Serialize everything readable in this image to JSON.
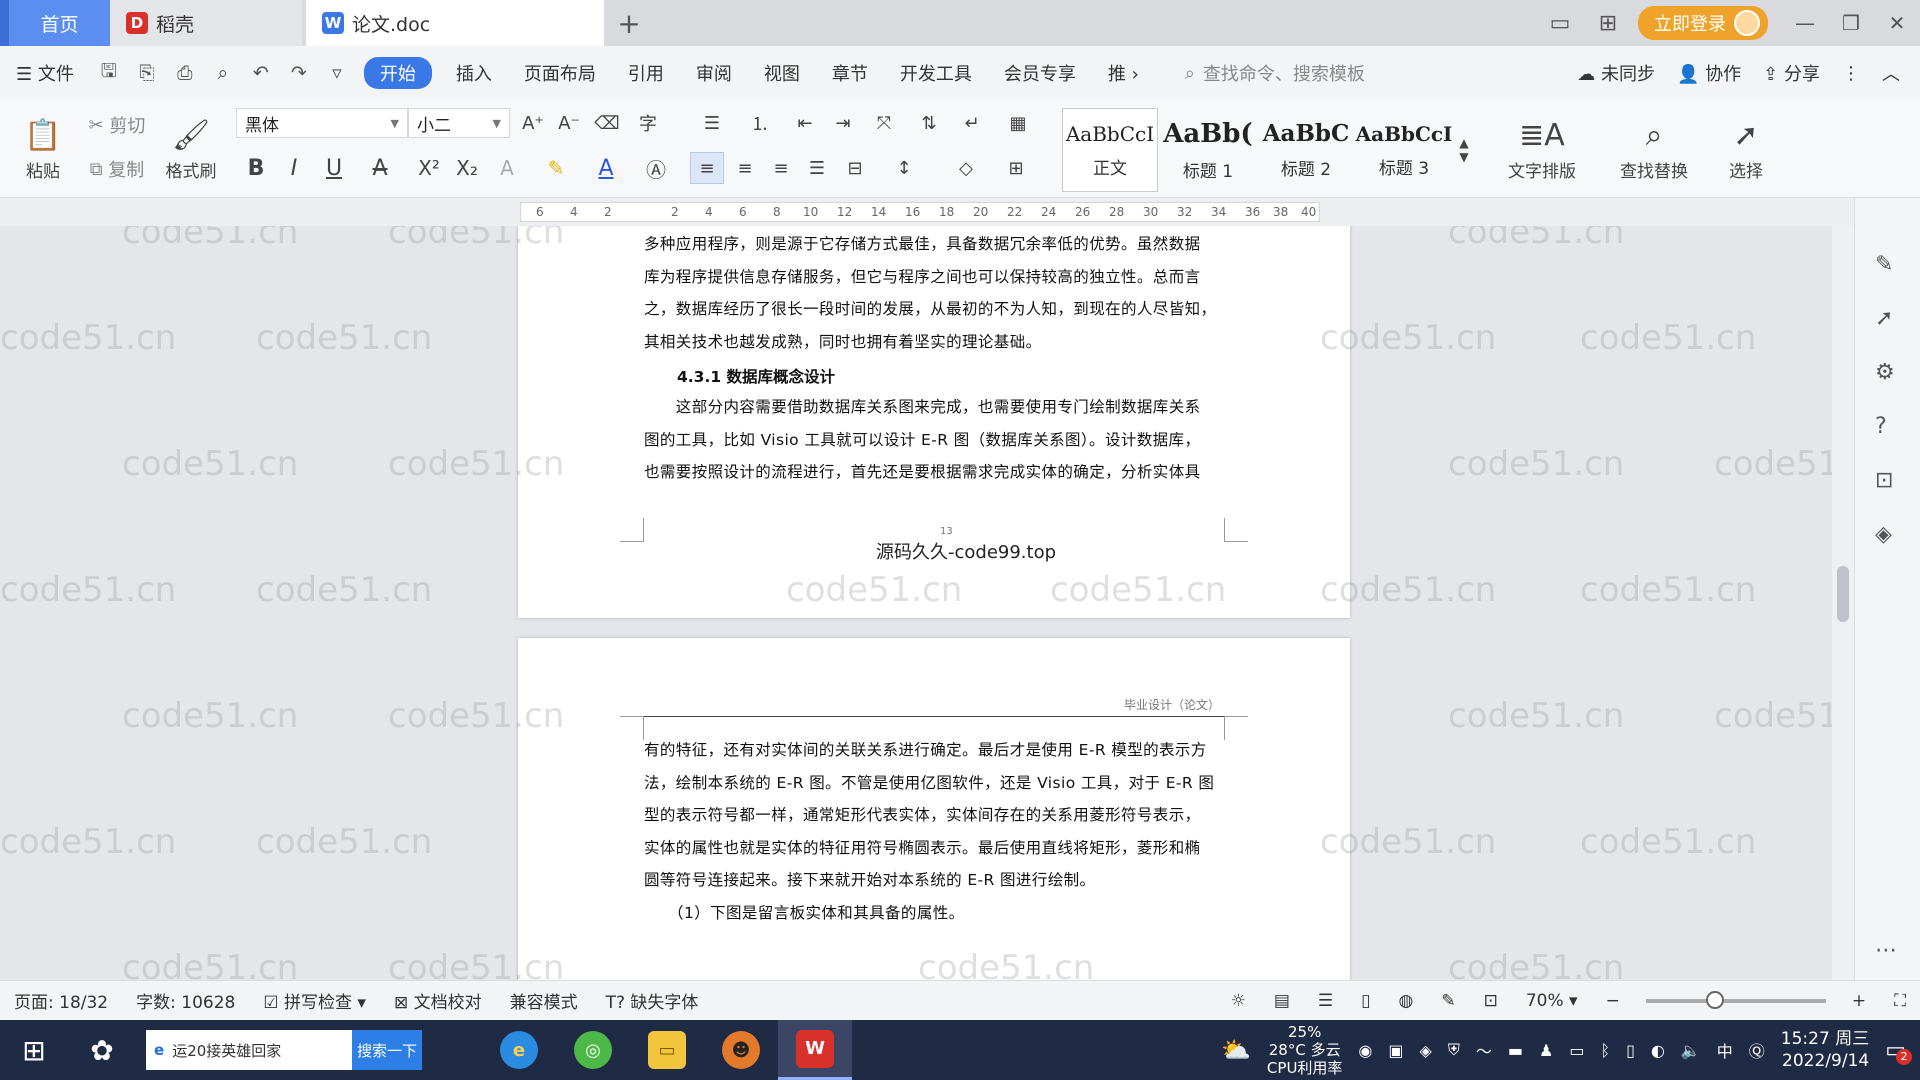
{
  "tabs": {
    "home": "首页",
    "docer": "稻壳",
    "doc": "论文.doc",
    "login": "立即登录"
  },
  "menu": {
    "file": "文件",
    "items": [
      "开始",
      "插入",
      "页面布局",
      "引用",
      "审阅",
      "视图",
      "章节",
      "开发工具",
      "会员专享",
      "推"
    ],
    "search_cmd": "查找命令、搜索模板",
    "unsynced": "未同步",
    "collab": "协作",
    "share": "分享"
  },
  "ribbon": {
    "paste": "粘贴",
    "cut": "剪切",
    "copy": "复制",
    "format_painter": "格式刷",
    "font_name": "黑体",
    "font_size": "小二",
    "styles": [
      {
        "sample": "AaBbCcI",
        "name": "正文"
      },
      {
        "sample": "AaBb(",
        "name": "标题 1"
      },
      {
        "sample": "AaBbC",
        "name": "标题 2"
      },
      {
        "sample": "AaBbCcI",
        "name": "标题 3"
      }
    ],
    "text_layout": "文字排版",
    "find_replace": "查找替换",
    "select": "选择"
  },
  "ruler": {
    "ticks": [
      "6",
      "4",
      "2",
      "",
      "2",
      "4",
      "6",
      "8",
      "10",
      "12",
      "14",
      "16",
      "18",
      "20",
      "22",
      "24",
      "26",
      "28",
      "30",
      "32",
      "34",
      "36",
      "38",
      "40"
    ]
  },
  "document": {
    "page1_lines": [
      "多种应用程序，则是源于它存储方式最佳，具备数据冗余率低的优势。虽然数据",
      "库为程序提供信息存储服务，但它与程序之间也可以保持较高的独立性。总而言",
      "之，数据库经历了很长一段时间的发展，从最初的不为人知，到现在的人尽皆知，",
      "其相关技术也越发成熟，同时也拥有着坚实的理论基础。"
    ],
    "heading": "4.3.1  数据库概念设计",
    "page1_lines_2": [
      "　　这部分内容需要借助数据库关系图来完成，也需要使用专门绘制数据库关系",
      "图的工具，比如 Visio 工具就可以设计 E-R 图（数据库关系图）。设计数据库，",
      "也需要按照设计的流程进行，首先还是要根据需求完成实体的确定，分析实体具"
    ],
    "page_number": "13",
    "footer": "源码久久-code99.top",
    "page2_header": "毕业设计（论文）",
    "page2_lines": [
      "有的特征，还有对实体间的关联关系进行确定。最后才是使用 E-R 模型的表示方",
      "法，绘制本系统的 E-R 图。不管是使用亿图软件，还是 Visio 工具，对于 E-R 图",
      "型的表示符号都一样，通常矩形代表实体，实体间存在的关系用菱形符号表示，",
      "实体的属性也就是实体的特征用符号椭圆表示。最后使用直线将矩形，菱形和椭",
      "圆等符号连接起来。接下来就开始对本系统的 E-R 图进行绘制。",
      "　　（1）下图是留言板实体和其具备的属性。"
    ],
    "watermark": "code51.cn"
  },
  "statusbar": {
    "page": "页面: 18/32",
    "words": "字数: 10628",
    "spellcheck": "拼写检查",
    "proofread": "文档校对",
    "compat": "兼容模式",
    "missing_fonts": "缺失字体",
    "zoom": "70%"
  },
  "taskbar": {
    "search_text": "运20接英雄回家",
    "search_button": "搜索一下",
    "weather_line1": "25%",
    "weather_temp": "28°C 多云",
    "cpu": "CPU利用率",
    "ime": "中",
    "time": "15:27 周三",
    "date": "2022/9/14",
    "notif_count": "2"
  }
}
